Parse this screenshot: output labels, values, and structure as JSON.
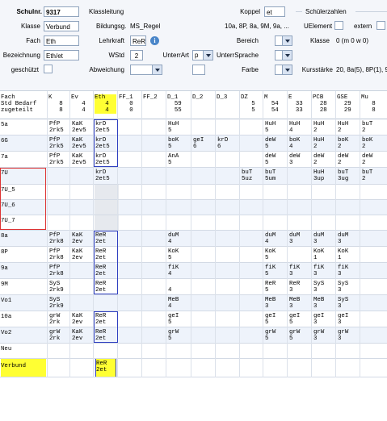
{
  "form": {
    "schulnr": {
      "label": "Schulnr.",
      "value": "9317"
    },
    "klasse": {
      "label": "Klasse",
      "value": "Verbund"
    },
    "fach": {
      "label": "Fach",
      "value": "Eth"
    },
    "bezeichnung": {
      "label": "Bezeichnung",
      "value": "Eth/et"
    },
    "geschuetzt": {
      "label": "geschützt"
    },
    "klassenleitung": {
      "label": "Klassleitung"
    },
    "bildungsg": {
      "label": "Bildungsg.",
      "value": "MS_Regel"
    },
    "lehrkraft": {
      "label": "Lehrkraft",
      "value": "ReR"
    },
    "wstd": {
      "label": "WStd",
      "value": "2"
    },
    "unterrart": {
      "label": "UnterrArt",
      "value": "p"
    },
    "unterrsprache": {
      "label": "UnterrSprache"
    },
    "abweichung": {
      "label": "Abweichung"
    },
    "koppel": {
      "label": "Koppel",
      "value": "et"
    },
    "koppel_list": "10a, 8P, 8a, 9M, 9a, ...",
    "bereich": {
      "label": "Bereich"
    },
    "farbe": {
      "label": "Farbe"
    },
    "schuelerzahlen": "Schülerzahlen",
    "uelement": "UElement",
    "extern": "extern",
    "klasse_count": {
      "label": "Klasse",
      "value": "0 (m 0 w 0)"
    },
    "kursstaerke": {
      "label": "Kursstärke",
      "value": "20, 8a(5), 8P(1), 9a..."
    }
  },
  "grid": {
    "row_labels": [
      "Fach",
      "Std Bedarf",
      "zugeteilt"
    ],
    "columns": [
      {
        "name": "K",
        "bedarf": "8",
        "zug": "8"
      },
      {
        "name": "Ev",
        "bedarf": "4",
        "zug": "4"
      },
      {
        "name": "Eth",
        "bedarf": "4",
        "zug": "4"
      },
      {
        "name": "FF_1",
        "bedarf": "0",
        "zug": "0"
      },
      {
        "name": "FF_2",
        "bedarf": "",
        "zug": ""
      },
      {
        "name": "D_1",
        "bedarf": "59",
        "zug": "55"
      },
      {
        "name": "D_2",
        "bedarf": "",
        "zug": ""
      },
      {
        "name": "D_3",
        "bedarf": "",
        "zug": ""
      },
      {
        "name": "DZ",
        "bedarf": "5",
        "zug": "5"
      },
      {
        "name": "M",
        "bedarf": "54",
        "zug": "54"
      },
      {
        "name": "E",
        "bedarf": "33",
        "zug": "33"
      },
      {
        "name": "PCB",
        "bedarf": "28",
        "zug": "28"
      },
      {
        "name": "GSE",
        "bedarf": "29",
        "zug": "29"
      },
      {
        "name": "Mu",
        "bedarf": "8",
        "zug": "8"
      }
    ],
    "rows": [
      {
        "name": "5a",
        "cells": [
          "PfP\n2rk5",
          "KaK\n2ev5",
          "krD\n2et5",
          "",
          "",
          "HuH\n5",
          "",
          "",
          "",
          "HuH\n5",
          "HuH\n4",
          "HuH\n2",
          "HuH\n2",
          "buT\n2"
        ]
      },
      {
        "name": "6G",
        "cells": [
          "PfP\n2rk5",
          "KaK\n2ev5",
          "krD\n2et5",
          "",
          "",
          "boK\n5",
          "geI\n6",
          "krD\n6",
          "",
          "deW\n5",
          "boK\n4",
          "HuH\n2",
          "boK\n2",
          "boK\n2"
        ]
      },
      {
        "name": "7a",
        "cells": [
          "PfP\n2rk5",
          "KaK\n2ev5",
          "krD\n2et5",
          "",
          "",
          "AnA\n5",
          "",
          "",
          "",
          "deW\n5",
          "deW\n3",
          "deW\n2",
          "deW\n2",
          "deW\n2"
        ]
      },
      {
        "name": "7U",
        "cells": [
          "",
          "",
          "krD\n2et5",
          "",
          "",
          "",
          "",
          "",
          "buT\n5uz",
          "buT\n5um",
          "",
          "HuH\n3up",
          "buT\n3ug",
          "buT\n2"
        ]
      },
      {
        "name": "7U_5",
        "cells": [
          "",
          "",
          "",
          "",
          "",
          "",
          "",
          "",
          "",
          "",
          "",
          "",
          "",
          ""
        ]
      },
      {
        "name": "7U_6",
        "cells": [
          "",
          "",
          "",
          "",
          "",
          "",
          "",
          "",
          "",
          "",
          "",
          "",
          "",
          ""
        ]
      },
      {
        "name": "7U_7",
        "cells": [
          "",
          "",
          "",
          "",
          "",
          "",
          "",
          "",
          "",
          "",
          "",
          "",
          "",
          ""
        ]
      },
      {
        "name": "8a",
        "cells": [
          "PfP\n2rk8",
          "KaK\n2ev",
          "ReR\n2et",
          "",
          "",
          "duM\n4",
          "",
          "",
          "",
          "duM\n4",
          "duM\n3",
          "duM\n3",
          "duM\n3",
          ""
        ]
      },
      {
        "name": "8P",
        "cells": [
          "PfP\n2rk8",
          "KaK\n2ev",
          "ReR\n2et",
          "",
          "",
          "KoK\n5",
          "",
          "",
          "",
          "KoK\n5",
          "",
          "KoK\n1",
          "KoK\n1",
          ""
        ]
      },
      {
        "name": "9a",
        "cells": [
          "PfP\n2rk8",
          "",
          "ReR\n2et",
          "",
          "",
          "fiK\n4",
          "",
          "",
          "",
          "fiK\n5",
          "fiK\n3",
          "fiK\n3",
          "fiK\n3",
          ""
        ]
      },
      {
        "name": "9M",
        "cells": [
          "SyS\n2rk9",
          "",
          "ReR\n2et",
          "",
          "",
          "\n4",
          "",
          "",
          "",
          "ReR\n5",
          "ReR\n3",
          "SyS\n3",
          "SyS\n3",
          ""
        ]
      },
      {
        "name": "Vo1",
        "cells": [
          "SyS\n2rk9",
          "",
          "",
          "",
          "",
          "MeB\n4",
          "",
          "",
          "",
          "MeB\n3",
          "MeB\n3",
          "MeB\n3",
          "SyS\n3",
          ""
        ]
      },
      {
        "name": "10a",
        "cells": [
          "grW\n2rk",
          "KaK\n2ev",
          "ReR\n2et",
          "",
          "",
          "geI\n5",
          "",
          "",
          "",
          "geI\n5",
          "geI\n5",
          "geI\n3",
          "geI\n3",
          ""
        ]
      },
      {
        "name": "Vo2",
        "cells": [
          "grW\n2rk",
          "KaK\n2ev",
          "ReR\n2et",
          "",
          "",
          "grW\n5",
          "",
          "",
          "",
          "grW\n5",
          "grW\n5",
          "grW\n3",
          "grW\n3",
          ""
        ]
      },
      {
        "name": "Neu",
        "cells": [
          "",
          "",
          "",
          "",
          "",
          "",
          "",
          "",
          "",
          "",
          "",
          "",
          "",
          ""
        ]
      },
      {
        "name": "Verbund",
        "cells": [
          "",
          "",
          "ReR\n2et",
          "",
          "",
          "",
          "",
          "",
          "",
          "",
          "",
          "",
          "",
          ""
        ]
      }
    ]
  },
  "colors": {
    "highlight": "#ffff33",
    "selection": "#3040c0",
    "accent": "#4a86c9",
    "red": "#dd3333"
  }
}
